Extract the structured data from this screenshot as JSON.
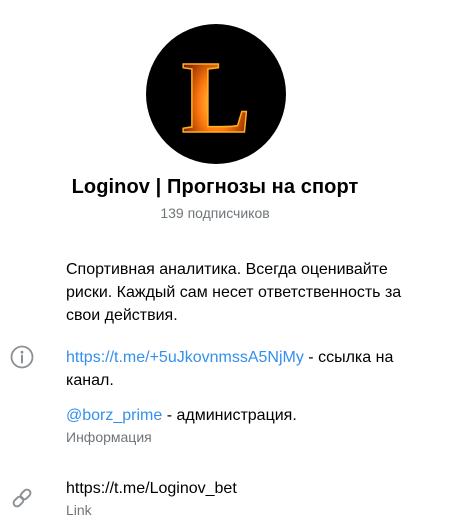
{
  "channel": {
    "avatar_letter": "L",
    "title": "Loginov | Прогнозы на спорт",
    "subscribers": "139 подписчиков"
  },
  "description": "Спортивная аналитика. Всегда оценивайте риски. Каждый сам несет ответственность за свои действия.",
  "info": {
    "invite_link": "https://t.me/+5uJkovnmssA5NjMy",
    "invite_suffix": " - ссылка на канал.",
    "admin_handle": "@borz_prime",
    "admin_suffix": " - администрация.",
    "caption": "Информация"
  },
  "link": {
    "url": "https://t.me/Loginov_bet",
    "caption": "Link"
  },
  "colors": {
    "link": "#3390ec",
    "secondary_text": "#707579",
    "icon": "#8a8f93"
  },
  "icons": {
    "info_row": "info-icon",
    "link_row": "link-icon"
  }
}
